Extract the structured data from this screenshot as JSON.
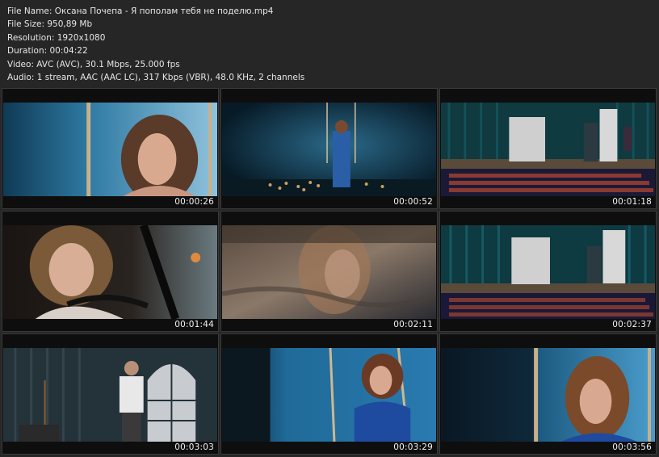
{
  "file_info": {
    "name_line": "File Name: Оксана Почепа - Я пополам тебя не поделю.mp4",
    "size_line": "File Size: 950,89 Mb",
    "resolution_line": "Resolution: 1920x1080",
    "duration_line": "Duration: 00:04:22",
    "video_line": "Video: AVC (AVC), 30.1 Mbps, 25.000 fps",
    "audio_line": "Audio: 1 stream, AAC (AAC LC), 317 Kbps (VBR), 48.0 KHz, 2 channels"
  },
  "thumbnails": [
    {
      "time": "00:00:26"
    },
    {
      "time": "00:00:52"
    },
    {
      "time": "00:01:18"
    },
    {
      "time": "00:01:44"
    },
    {
      "time": "00:02:11"
    },
    {
      "time": "00:02:37"
    },
    {
      "time": "00:03:03"
    },
    {
      "time": "00:03:29"
    },
    {
      "time": "00:03:56"
    }
  ]
}
